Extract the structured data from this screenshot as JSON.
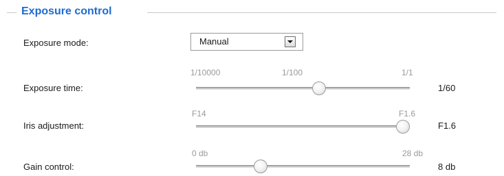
{
  "section": {
    "title": "Exposure control"
  },
  "exposure_mode": {
    "label": "Exposure mode:",
    "selected": "Manual"
  },
  "exposure_time": {
    "label": "Exposure time:",
    "ticks": [
      "1/10000",
      "1/100",
      "1/1"
    ],
    "value": "1/60",
    "position_fraction": 0.58
  },
  "iris_adjustment": {
    "label": "Iris adjustment:",
    "ticks": [
      "F14",
      "F1.6"
    ],
    "value": "F1.6",
    "position_fraction": 1.0
  },
  "gain_control": {
    "label": "Gain control:",
    "ticks": [
      "0 db",
      "28 db"
    ],
    "value": "8 db",
    "position_fraction": 0.29
  }
}
